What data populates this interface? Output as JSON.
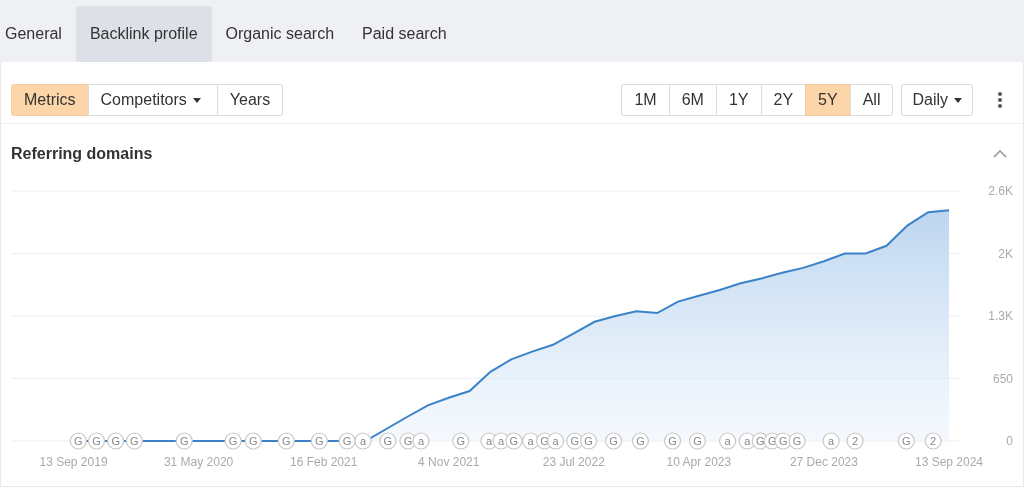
{
  "tabs": [
    {
      "label": "General",
      "selected": false
    },
    {
      "label": "Backlink profile",
      "selected": true
    },
    {
      "label": "Organic search",
      "selected": false
    },
    {
      "label": "Paid search",
      "selected": false
    }
  ],
  "view_buttons": [
    {
      "label": "Metrics",
      "selected": true,
      "kind": "plain"
    },
    {
      "label": "Competitors",
      "selected": false,
      "kind": "dropdown"
    },
    {
      "label": "Years",
      "selected": false,
      "kind": "plain"
    }
  ],
  "ranges": [
    {
      "label": "1M",
      "selected": false
    },
    {
      "label": "6M",
      "selected": false
    },
    {
      "label": "1Y",
      "selected": false
    },
    {
      "label": "2Y",
      "selected": false
    },
    {
      "label": "5Y",
      "selected": true
    },
    {
      "label": "All",
      "selected": false
    }
  ],
  "interval": {
    "label": "Daily"
  },
  "panel": {
    "title": "Referring domains",
    "expanded": true,
    "chart_data": {
      "type": "area",
      "categories": [
        null,
        null,
        null,
        "13 Sep 2019",
        null,
        null,
        null,
        null,
        null,
        "31 May 2020",
        null,
        null,
        null,
        null,
        null,
        "16 Feb 2021",
        null,
        null,
        null,
        null,
        null,
        "4 Nov 2021",
        null,
        null,
        null,
        null,
        null,
        "23 Jul 2022",
        null,
        null,
        null,
        null,
        null,
        "10 Apr 2023",
        null,
        null,
        null,
        null,
        null,
        "27 Dec 2023",
        null,
        null,
        null,
        null,
        null,
        "13 Sep 2024"
      ],
      "series": [
        {
          "color": "#3b82c8",
          "values": [
            null,
            null,
            null,
            0,
            0,
            0,
            0,
            0,
            0,
            0,
            0,
            0,
            0,
            0,
            0,
            0,
            0,
            0,
            null,
            250,
            370,
            450,
            520,
            720,
            850,
            930,
            1000,
            1120,
            1240,
            1300,
            1350,
            1330,
            1450,
            1510,
            1570,
            1640,
            1690,
            1750,
            1800,
            1870,
            1950,
            1950,
            2030,
            2240,
            2380,
            2400
          ]
        }
      ],
      "ylim": [
        0,
        2600
      ],
      "grid": true,
      "yticks": [
        {
          "value": 0,
          "label": "0"
        },
        {
          "value": 650,
          "label": "650"
        },
        {
          "value": 1300,
          "label": "1.3K"
        },
        {
          "value": 1950,
          "label": "2K"
        },
        {
          "value": 2600,
          "label": "2.6K"
        }
      ],
      "annotations": [
        "G",
        "G",
        "G",
        "G",
        "G",
        "G",
        "G",
        "G",
        "G",
        "G",
        "a",
        "G",
        "G",
        "a",
        "G",
        "a",
        "a",
        "G",
        "a",
        "G",
        "a",
        "G",
        "G",
        "G",
        "G",
        "G",
        "G",
        "a",
        "a",
        "G",
        "G",
        "G",
        "G",
        "a",
        "2",
        "G",
        "2"
      ]
    }
  }
}
